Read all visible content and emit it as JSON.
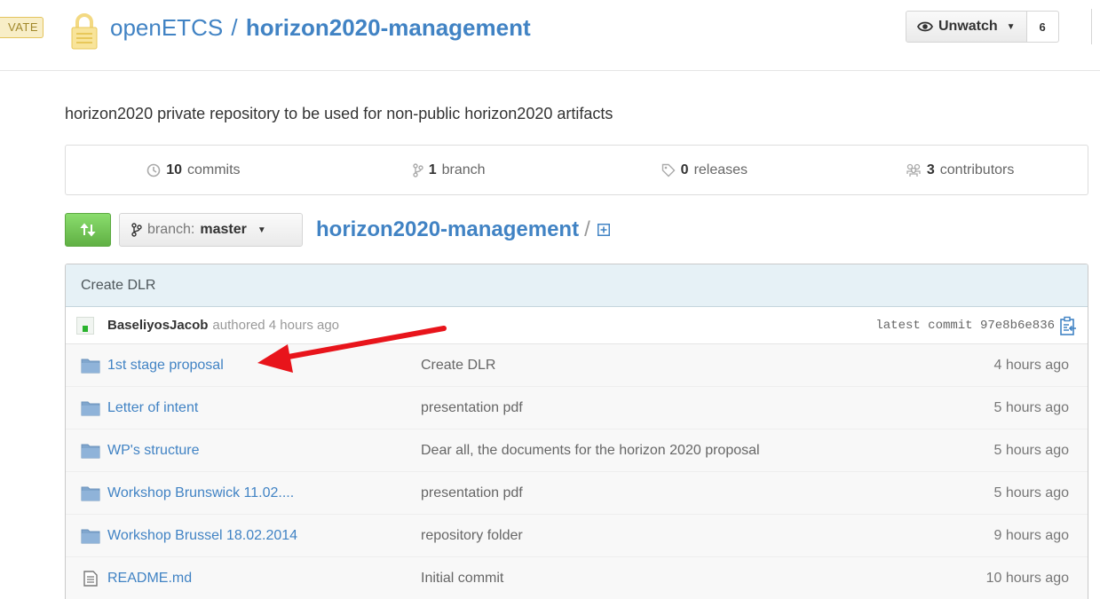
{
  "header": {
    "private_badge": "VATE",
    "owner": "openETCS",
    "separator": "/",
    "repo": "horizon2020-management",
    "watch_label": "Unwatch",
    "watch_count": "6"
  },
  "description": "horizon2020 private repository to be used for non-public horizon2020 artifacts",
  "numbers": {
    "commits_count": "10",
    "commits_label": "commits",
    "branches_count": "1",
    "branches_label": "branch",
    "releases_count": "0",
    "releases_label": "releases",
    "contributors_count": "3",
    "contributors_label": "contributors"
  },
  "nav": {
    "branch_prefix": "branch:",
    "branch_name": "master",
    "breadcrumb_repo": "horizon2020-management",
    "breadcrumb_sep": "/"
  },
  "commit": {
    "title": "Create DLR",
    "author": "BaseliyosJacob",
    "authored": "authored 4 hours ago",
    "latest": "latest commit 97e8b6e836"
  },
  "files": [
    {
      "type": "folder",
      "name": "1st stage proposal",
      "message": "Create DLR",
      "age": "4 hours ago"
    },
    {
      "type": "folder",
      "name": "Letter of intent",
      "message": "presentation pdf",
      "age": "5 hours ago"
    },
    {
      "type": "folder",
      "name": "WP's structure",
      "message": "Dear all, the documents for the horizon 2020 proposal",
      "age": "5 hours ago"
    },
    {
      "type": "folder",
      "name": "Workshop Brunswick 11.02....",
      "message": "presentation pdf",
      "age": "5 hours ago"
    },
    {
      "type": "folder",
      "name": "Workshop Brussel 18.02.2014",
      "message": "repository folder",
      "age": "9 hours ago"
    },
    {
      "type": "file",
      "name": "README.md",
      "message": "Initial commit",
      "age": "10 hours ago"
    }
  ],
  "colors": {
    "link": "#4183c4",
    "compare_green": "#6cc644",
    "annotation_red": "#e8141b",
    "commit_header_bg": "#e6f1f6"
  },
  "icons": {
    "lock": "lock-icon",
    "watch": "eye-icon",
    "commits": "history-icon",
    "branch": "git-branch-icon",
    "releases": "tag-icon",
    "contributors": "organization-icon",
    "compare": "compare-icon",
    "new_file": "plus-square-icon",
    "folder": "folder-icon",
    "file": "file-text-icon",
    "clipboard": "clippy-icon"
  }
}
